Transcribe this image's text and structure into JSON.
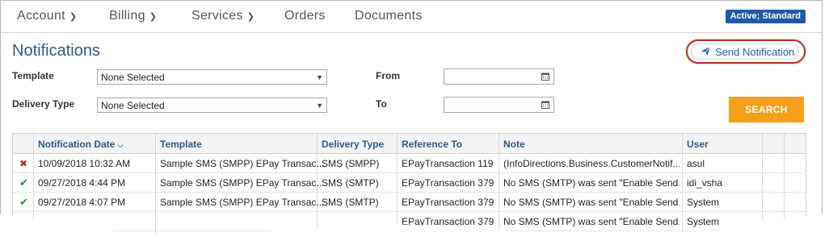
{
  "nav": {
    "items": [
      {
        "label": "Account",
        "has_menu": true
      },
      {
        "label": "Billing",
        "has_menu": true
      },
      {
        "label": "Services",
        "has_menu": true
      },
      {
        "label": "Orders",
        "has_menu": false
      },
      {
        "label": "Documents",
        "has_menu": false
      }
    ],
    "status_badge": "Active; Standard"
  },
  "page": {
    "title": "Notifications",
    "send_button_label": "Send Notification"
  },
  "filters": {
    "template_label": "Template",
    "template_value": "None Selected",
    "delivery_label": "Delivery Type",
    "delivery_value": "None Selected",
    "from_label": "From",
    "to_label": "To",
    "search_label": "SEARCH"
  },
  "table": {
    "columns": [
      "Notification Date",
      "Template",
      "Delivery Type",
      "Reference To",
      "Note",
      "User"
    ],
    "sort_column": "Notification Date",
    "rows": [
      {
        "status": "error",
        "date": "10/09/2018 10:32 AM",
        "template": "Sample SMS (SMPP) EPay Transac...",
        "delivery": "SMS (SMPP)",
        "reference": "EPayTransaction 119",
        "note": "(InfoDirections.Business.CustomerNotif...",
        "user": "asul"
      },
      {
        "status": "ok",
        "date": "09/27/2018 4:44 PM",
        "template": "Sample SMS (SMPP) EPay Transac...",
        "delivery": "SMS (SMTP)",
        "reference": "EPayTransaction 379",
        "note": "No SMS (SMTP) was sent \"Enable Send...",
        "user": "idi_vsha"
      },
      {
        "status": "ok",
        "date": "09/27/2018 4:07 PM",
        "template": "Sample SMS (SMPP) EPay Transac...",
        "delivery": "SMS (SMTP)",
        "reference": "EPayTransaction 379",
        "note": "No SMS (SMTP) was sent \"Enable Send...",
        "user": "System"
      },
      {
        "status": "ok",
        "date": "",
        "template": "",
        "delivery": "",
        "reference": "EPayTransaction 379",
        "note": "No SMS (SMTP) was sent \"Enable Send...",
        "user": "System"
      }
    ]
  },
  "colors": {
    "accent": "#1f5aa8",
    "title": "#2a5a8a",
    "search": "#f5a01a",
    "highlight_ring": "#b3342b"
  }
}
